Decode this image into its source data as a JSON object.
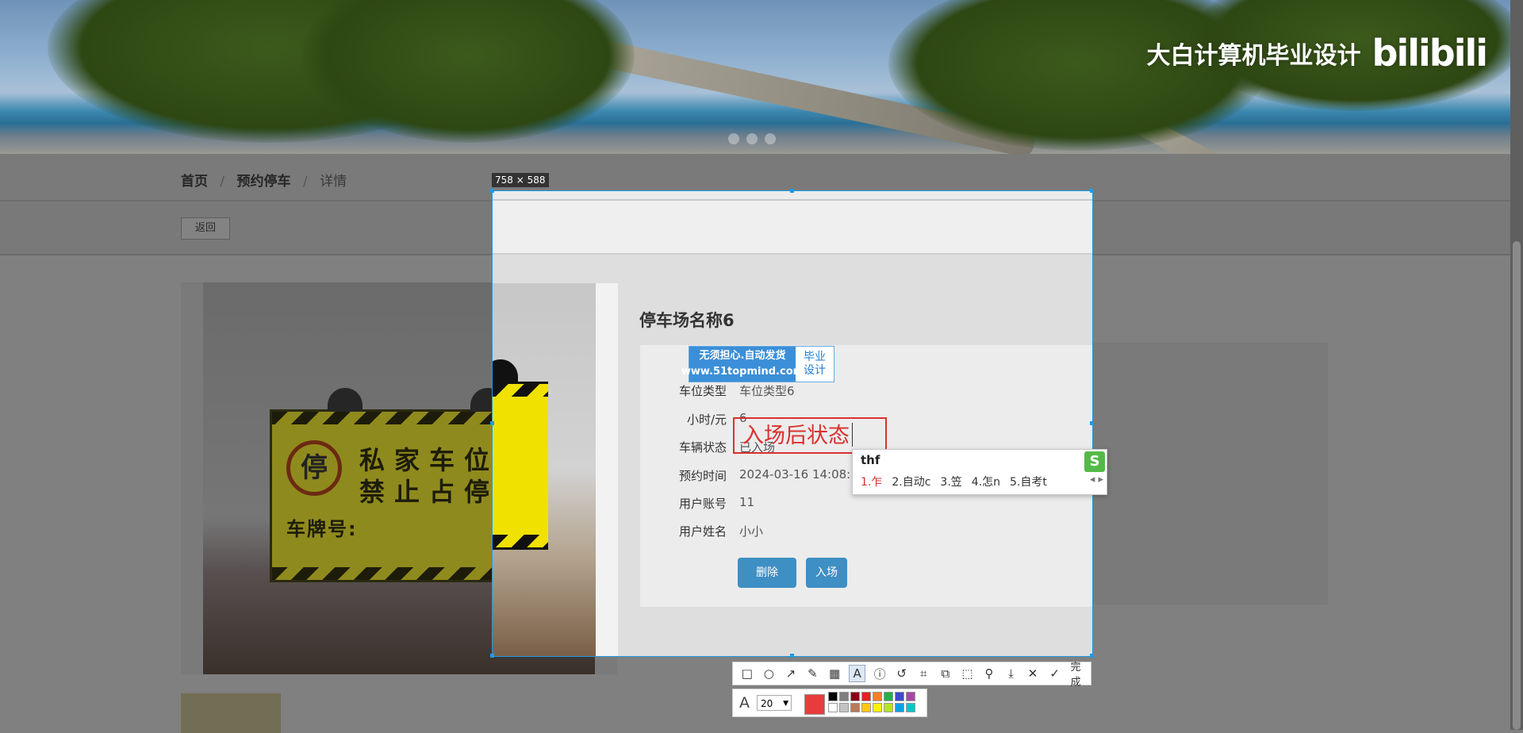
{
  "header": {
    "brand_text": "大白计算机毕业设计",
    "brand_logo": "bilibili"
  },
  "breadcrumb": {
    "home": "首页",
    "section": "预约停车",
    "current": "详情",
    "separator": "/"
  },
  "back_button": "返回",
  "sign_image": {
    "symbol": "停",
    "line1": "私家车位",
    "line2": "禁止占停",
    "plate_label": "车牌号:"
  },
  "detail": {
    "title": "停车场名称6",
    "fields": [
      {
        "label": "车位类型",
        "value": "车位类型6"
      },
      {
        "label": "小时/元",
        "value": "6"
      },
      {
        "label": "车辆状态",
        "value": "已入场"
      },
      {
        "label": "预约时间",
        "value": "2024-03-16 14:08:"
      },
      {
        "label": "用户账号",
        "value": "11"
      },
      {
        "label": "用户姓名",
        "value": "小小"
      }
    ],
    "delete_button": "删除",
    "enter_button": "入场"
  },
  "watermark": {
    "line1": "无须担心.自动发货",
    "line2": "www.51topmind.com",
    "right1": "毕业",
    "right2": "设计"
  },
  "screenshot_tool": {
    "size_label": "758 × 588",
    "annotation_text": "入场后状态",
    "font_size": "20",
    "done_label": "完成",
    "selected_color": "#e83c3c",
    "palette": [
      "#000000",
      "#7f7f7f",
      "#880015",
      "#ed1c24",
      "#ff7f27",
      "#22b14c",
      "#3f48cc",
      "#a349a4",
      "#ffffff",
      "#c3c3c3",
      "#b97a57",
      "#ffc90e",
      "#fff200",
      "#b5e61d",
      "#00a2e8",
      "#00c8c8"
    ],
    "tools": [
      "rectangle-icon",
      "ellipse-icon",
      "arrow-icon",
      "pen-icon",
      "mosaic-icon",
      "text-icon",
      "number-icon",
      "undo-icon",
      "crop-icon",
      "copy-icon",
      "ocr-icon",
      "pin-icon",
      "save-icon",
      "cancel-icon",
      "done-icon"
    ]
  },
  "ime": {
    "composition": "thf",
    "candidates": [
      "1.乍",
      "2.自动c",
      "3.笠",
      "4.怎n",
      "5.自考t"
    ]
  }
}
